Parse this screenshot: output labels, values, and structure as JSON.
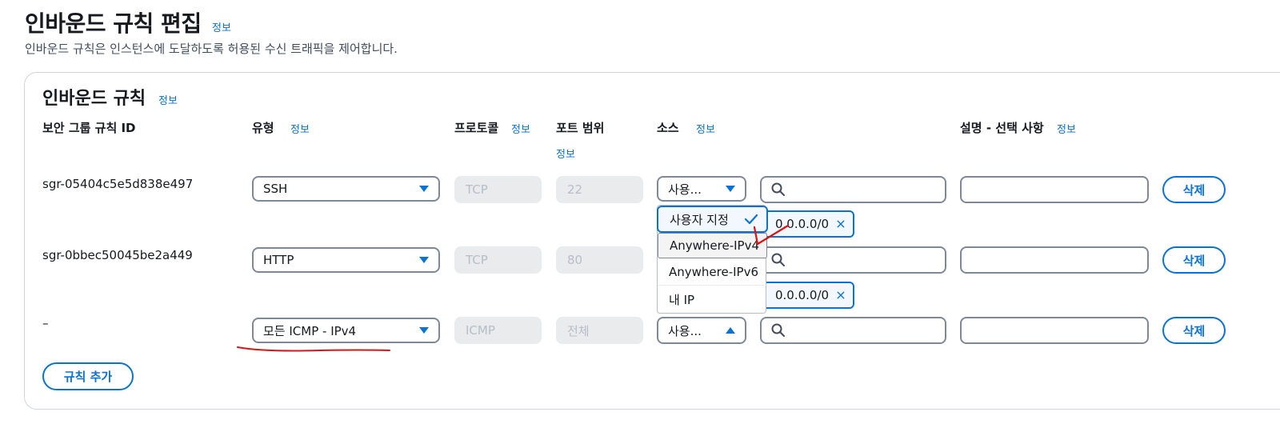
{
  "header": {
    "title": "인바운드 규칙 편집",
    "info": "정보",
    "description": "인바운드 규칙은 인스턴스에 도달하도록 허용된 수신 트래픽을 제어합니다."
  },
  "section": {
    "title": "인바운드 규칙",
    "info": "정보",
    "columns": {
      "rule_id": "보안 그룹 규칙 ID",
      "type": "유형",
      "type_info": "정보",
      "protocol": "프로토콜",
      "protocol_info": "정보",
      "port_range": "포트 범위",
      "port_info": "정보",
      "source": "소스",
      "source_info": "정보",
      "description": "설명 - 선택 사항",
      "description_info": "정보"
    }
  },
  "rows": [
    {
      "id": "sgr-05404c5e5d838e497",
      "type": "SSH",
      "protocol": "TCP",
      "port": "22",
      "source": "사용...",
      "token": "0.0.0.0/0",
      "delete": "삭제"
    },
    {
      "id": "sgr-0bbec50045be2a449",
      "type": "HTTP",
      "protocol": "TCP",
      "port": "80",
      "source": "",
      "token": "0.0.0.0/0",
      "delete": "삭제"
    },
    {
      "id": "–",
      "type": "모든 ICMP - IPv4",
      "protocol": "ICMP",
      "port": "전체",
      "source": "사용...",
      "token": "",
      "delete": "삭제"
    }
  ],
  "dropdown": {
    "options": [
      "사용자 지정",
      "Anywhere-IPv4",
      "Anywhere-IPv6",
      "내 IP"
    ],
    "selected": "사용자 지정"
  },
  "add_rule_button": "규칙 추가",
  "colors": {
    "accent": "#0972d3",
    "annotation": "#d91515"
  }
}
